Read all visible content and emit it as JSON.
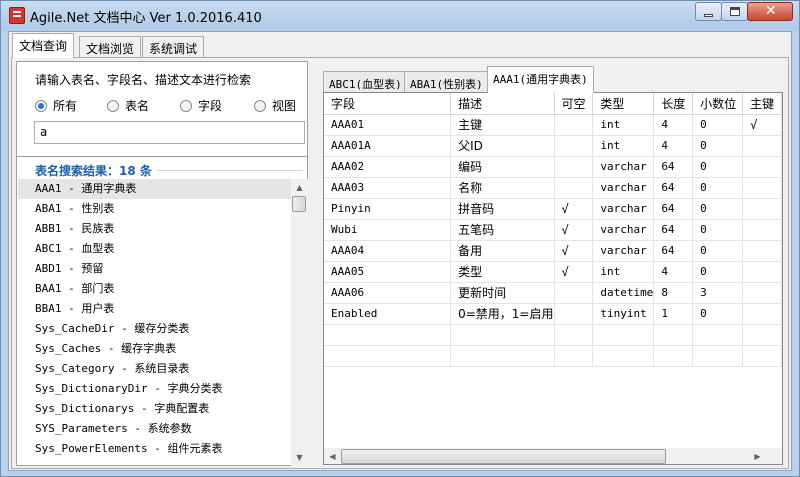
{
  "window": {
    "title": "Agile.Net 文档中心 Ver 1.0.2016.410"
  },
  "top_tabs": [
    "文档查询",
    "文档浏览",
    "系统调试"
  ],
  "search": {
    "label": "请输入表名、字段名、描述文本进行检索",
    "radios": [
      "所有",
      "表名",
      "字段",
      "视图"
    ],
    "selected_radio": "所有",
    "value": "a"
  },
  "results": {
    "title": "表名搜索结果：18 条",
    "items": [
      "AAA1 - 通用字典表",
      "ABA1 - 性别表",
      "ABB1 - 民族表",
      "ABC1 - 血型表",
      "ABD1 - 预留",
      "BAA1 - 部门表",
      "BBA1 - 用户表",
      "Sys_CacheDir - 缓存分类表",
      "Sys_Caches - 缓存字典表",
      "Sys_Category - 系统目录表",
      "Sys_DictionaryDir - 字典分类表",
      "Sys_Dictionarys - 字典配置表",
      "SYS_Parameters - 系统参数",
      "Sys_PowerElements - 组件元素表"
    ],
    "selected_index": 0
  },
  "doc_tabs": [
    "ABC1(血型表)",
    "ABA1(性别表)",
    "AAA1(通用字典表)"
  ],
  "active_doc_tab": 2,
  "grid": {
    "columns": [
      "字段",
      "描述",
      "可空",
      "类型",
      "长度",
      "小数位",
      "主键"
    ],
    "rows": [
      [
        "AAA01",
        "主键",
        "",
        "int",
        "4",
        "0",
        "√"
      ],
      [
        "AAA01A",
        "父ID",
        "",
        "int",
        "4",
        "0",
        ""
      ],
      [
        "AAA02",
        "编码",
        "",
        "varchar",
        "64",
        "0",
        ""
      ],
      [
        "AAA03",
        "名称",
        "",
        "varchar",
        "64",
        "0",
        ""
      ],
      [
        "Pinyin",
        "拼音码",
        "√",
        "varchar",
        "64",
        "0",
        ""
      ],
      [
        "Wubi",
        "五笔码",
        "√",
        "varchar",
        "64",
        "0",
        ""
      ],
      [
        "AAA04",
        "备用",
        "√",
        "varchar",
        "64",
        "0",
        ""
      ],
      [
        "AAA05",
        "类型",
        "√",
        "int",
        "4",
        "0",
        ""
      ],
      [
        "AAA06",
        "更新时间",
        "",
        "datetime",
        "8",
        "3",
        ""
      ],
      [
        "Enabled",
        "0=禁用，1=启用",
        "",
        "tinyint",
        "1",
        "0",
        ""
      ]
    ]
  },
  "icons": {
    "app": "document-app-icon",
    "minimize": "minimize-icon",
    "maximize": "maximize-icon",
    "close": "close-icon"
  }
}
